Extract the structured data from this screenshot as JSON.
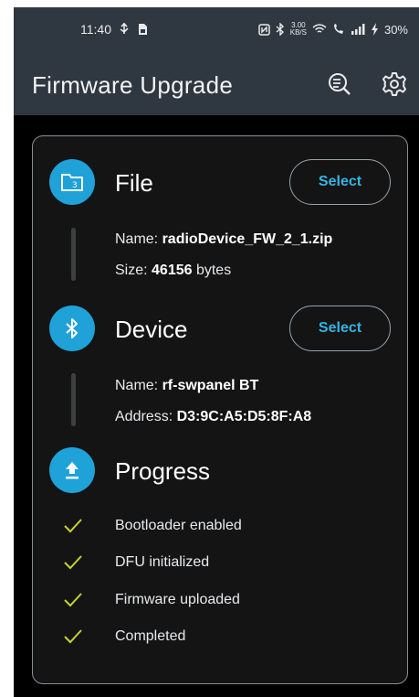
{
  "status_bar": {
    "time": "11:40",
    "speed_value": "3.00",
    "speed_unit": "KB/S",
    "battery": "30%",
    "icons": [
      "usb-icon",
      "sim-icon",
      "nfc-icon",
      "bluetooth-icon",
      "wifi-icon",
      "call-icon",
      "signal-icon",
      "charging-icon"
    ]
  },
  "app_bar": {
    "title": "Firmware Upgrade",
    "icons": [
      "search-log-icon",
      "settings-icon"
    ]
  },
  "file": {
    "title": "File",
    "select_label": "Select",
    "name_label": "Name: ",
    "name_value": "radioDevice_FW_2_1.zip",
    "size_label": "Size: ",
    "size_value": "46156",
    "size_unit": " bytes"
  },
  "device": {
    "title": "Device",
    "select_label": "Select",
    "name_label": "Name: ",
    "name_value": "rf-swpanel BT",
    "address_label": "Address: ",
    "address_value": "D3:9C:A5:D5:8F:A8"
  },
  "progress": {
    "title": "Progress",
    "steps": [
      {
        "label": "Bootloader enabled"
      },
      {
        "label": "DFU initialized"
      },
      {
        "label": "Firmware uploaded"
      },
      {
        "label": "Completed"
      }
    ]
  },
  "colors": {
    "accent": "#1fa2d8",
    "check": "#c6d52e",
    "app_bar": "#2f3740"
  }
}
